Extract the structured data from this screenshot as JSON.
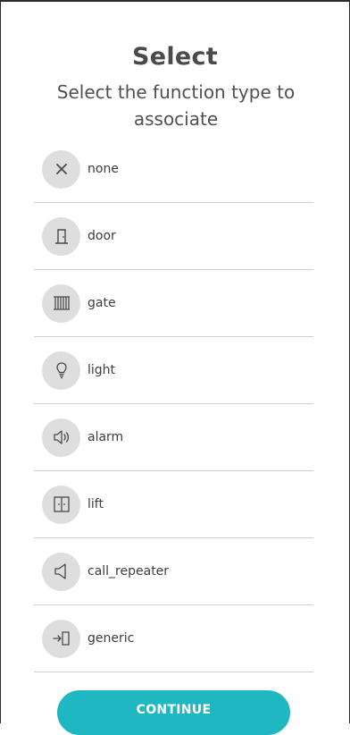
{
  "title": "Select",
  "subtitle": "Select the function type to associate",
  "items": [
    {
      "label": "none",
      "icon": "close-icon"
    },
    {
      "label": "door",
      "icon": "door-icon"
    },
    {
      "label": "gate",
      "icon": "gate-icon"
    },
    {
      "label": "light",
      "icon": "lightbulb-icon"
    },
    {
      "label": "alarm",
      "icon": "speaker-icon"
    },
    {
      "label": "lift",
      "icon": "elevator-icon"
    },
    {
      "label": "call_repeater",
      "icon": "speaker-muted-icon"
    },
    {
      "label": "generic",
      "icon": "enter-door-icon"
    }
  ],
  "continue_label": "CONTINUE",
  "colors": {
    "accent": "#1fb7c1",
    "icon_bg": "#dedede",
    "divider": "#cfcfcf",
    "text": "#454545"
  }
}
